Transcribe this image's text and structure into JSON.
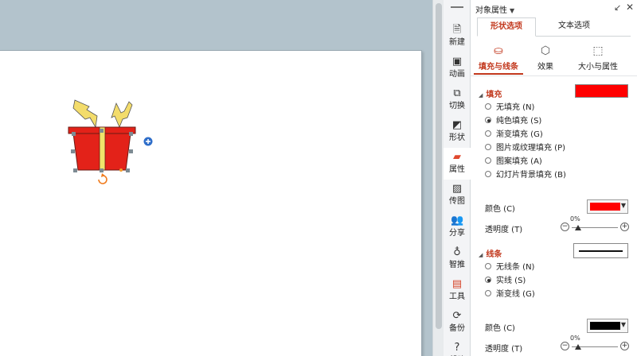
{
  "panel": {
    "title": "对象属性",
    "tabs": [
      {
        "label": "形状选项",
        "active": true
      },
      {
        "label": "文本选项",
        "active": false
      }
    ],
    "subtabs": [
      {
        "label": "填充与线条",
        "icon": "paint-bucket-icon",
        "active": true
      },
      {
        "label": "效果",
        "icon": "cube-icon",
        "active": false
      },
      {
        "label": "大小与属性",
        "icon": "size-box-icon",
        "active": false
      }
    ],
    "fill": {
      "heading": "填充",
      "swatch_color": "#ff0000",
      "options": [
        {
          "label": "无填充 (N)",
          "selected": false
        },
        {
          "label": "纯色填充 (S)",
          "selected": true
        },
        {
          "label": "渐变填充 (G)",
          "selected": false
        },
        {
          "label": "图片或纹理填充 (P)",
          "selected": false
        },
        {
          "label": "图案填充 (A)",
          "selected": false
        },
        {
          "label": "幻灯片背景填充 (B)",
          "selected": false
        }
      ],
      "color_label": "颜色 (C)",
      "color_value": "#ff0000",
      "transparency_label": "透明度 (T)",
      "transparency_value": "0%"
    },
    "line": {
      "heading": "线条",
      "options": [
        {
          "label": "无线条 (N)",
          "selected": false
        },
        {
          "label": "实线 (S)",
          "selected": true
        },
        {
          "label": "渐变线 (G)",
          "selected": false
        }
      ],
      "color_label": "颜色 (C)",
      "color_value": "#000000",
      "transparency_label": "透明度 (T)",
      "transparency_value": "0%"
    }
  },
  "sidebar": {
    "items": [
      {
        "label": "新建",
        "icon": "new-doc-icon",
        "active": false
      },
      {
        "label": "动画",
        "icon": "animation-icon",
        "active": false
      },
      {
        "label": "切换",
        "icon": "transition-icon",
        "active": false
      },
      {
        "label": "形状",
        "icon": "shapes-icon",
        "active": false
      },
      {
        "label": "属性",
        "icon": "properties-icon",
        "active": true
      },
      {
        "label": "传图",
        "icon": "image-upload-icon",
        "active": false
      },
      {
        "label": "分享",
        "icon": "share-icon",
        "active": false
      },
      {
        "label": "智推",
        "icon": "recommend-icon",
        "active": false
      },
      {
        "label": "工具",
        "icon": "toolbox-icon",
        "active": false
      },
      {
        "label": "备份",
        "icon": "backup-icon",
        "active": false
      },
      {
        "label": "帮助",
        "icon": "help-icon",
        "active": false
      }
    ]
  },
  "colors": {
    "accent": "#c2381d",
    "gift_red": "#e32219",
    "lightning": "#f3dc6b",
    "ribbon": "#f0e46a"
  }
}
